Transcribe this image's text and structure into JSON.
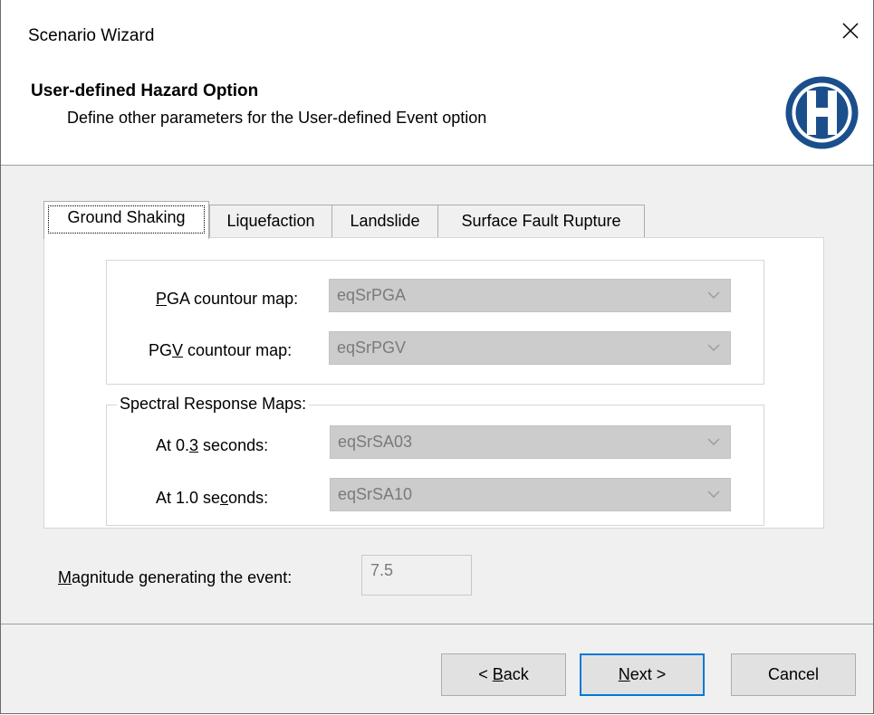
{
  "window": {
    "title": "Scenario Wizard"
  },
  "header": {
    "title": "User-defined Hazard Option",
    "subtitle": "Define other parameters for the User-defined Event option",
    "logo_letter": "H"
  },
  "tabs": [
    {
      "label": "Ground Shaking",
      "active": true
    },
    {
      "label": "Liquefaction",
      "active": false
    },
    {
      "label": "Landslide",
      "active": false
    },
    {
      "label": "Surface Fault Rupture",
      "active": false
    }
  ],
  "ground_shaking": {
    "pga": {
      "label_pre": "",
      "label_mnemonic": "P",
      "label_post": "GA countour map:",
      "value": "eqSrPGA"
    },
    "pgv": {
      "label_pre": "PG",
      "label_mnemonic": "V",
      "label_post": " countour map:",
      "value": "eqSrPGV"
    },
    "spectral": {
      "legend": "Spectral Response Maps:",
      "sa03": {
        "label_pre": "At 0.",
        "label_mnemonic": "3",
        "label_post": " seconds:",
        "value": "eqSrSA03"
      },
      "sa10": {
        "label_pre": "At 1.0 se",
        "label_mnemonic": "c",
        "label_post": "onds:",
        "value": "eqSrSA10"
      }
    }
  },
  "magnitude": {
    "label_mnemonic": "M",
    "label_post": "agnitude generating the event:",
    "value": "7.5"
  },
  "buttons": {
    "back": {
      "label_pre": "< ",
      "label_mnemonic": "B",
      "label_post": "ack"
    },
    "next": {
      "label_pre": "",
      "label_mnemonic": "N",
      "label_post": "ext >"
    },
    "cancel": {
      "label": "Cancel"
    }
  },
  "colors": {
    "accent": "#0078d7",
    "logo": "#1b4f8c",
    "disabled_field": "#cccccc"
  }
}
